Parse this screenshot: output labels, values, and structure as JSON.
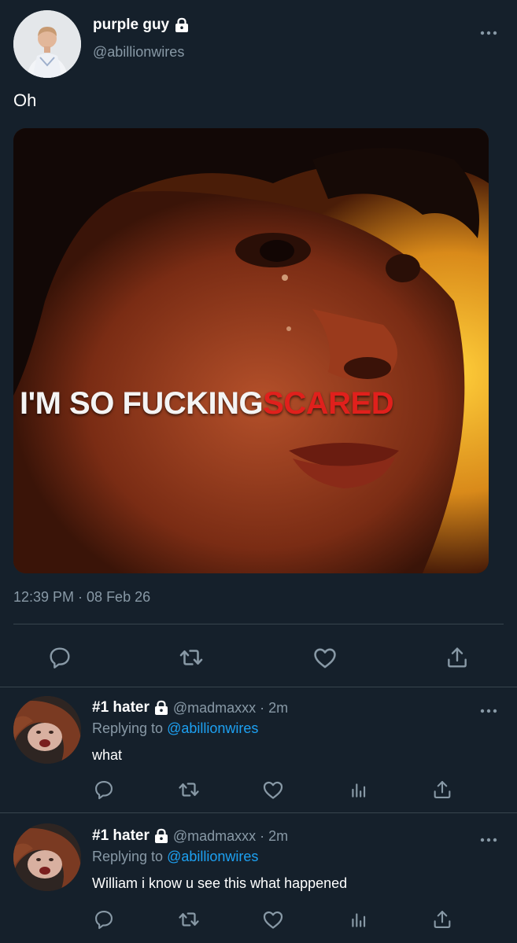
{
  "main_tweet": {
    "display_name": "purple guy",
    "handle": "@abillionwires",
    "text": "Oh",
    "media_caption_white": "I'M SO FUCKING",
    "media_caption_red": "SCARED",
    "timestamp": "12:39 PM · 08 Feb 26",
    "icons": [
      "lock-icon",
      "more-icon",
      "reply-icon",
      "retweet-icon",
      "like-icon",
      "share-icon"
    ]
  },
  "replies": [
    {
      "display_name": "#1 hater",
      "handle": "@madmaxxx",
      "time": "· 2m",
      "replying_prefix": "Replying to",
      "replying_to": "@abillionwires",
      "text": "what"
    },
    {
      "display_name": "#1 hater",
      "handle": "@madmaxxx",
      "time": "· 2m",
      "replying_prefix": "Replying to",
      "replying_to": "@abillionwires",
      "text": "William i know u see this what happened"
    }
  ],
  "colors": {
    "background": "#15202b",
    "secondary_text": "#8899a6",
    "link": "#1da1f2",
    "divider": "#38444d",
    "caption_red": "#e0201c"
  }
}
